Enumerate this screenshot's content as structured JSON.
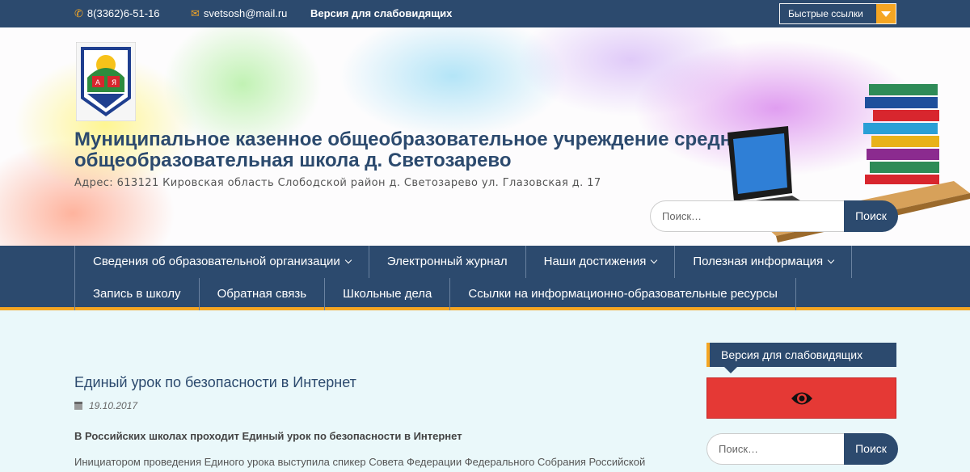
{
  "topbar": {
    "phone": "8(3362)6-51-16",
    "phone_icon": "phone-icon",
    "email": "svetsosh@mail.ru",
    "email_icon": "envelope-icon",
    "vision_link": "Версия для слабовидящих",
    "quick_links": "Быстрые ссылки"
  },
  "header": {
    "title": "Муниципальное казенное общеобразовательное учреждение средняя общеобразовательная школа д. Светозарево",
    "address": "Адрес: 613121 Кировская область Слободской район д. Светозарево ул. Глазовская д. 17",
    "search_placeholder": "Поиск…",
    "search_button": "Поиск"
  },
  "nav": {
    "row1": [
      {
        "label": "Сведения об образовательной организации",
        "dropdown": true
      },
      {
        "label": "Электронный журнал",
        "dropdown": false
      },
      {
        "label": "Наши достижения",
        "dropdown": true
      },
      {
        "label": "Полезная информация",
        "dropdown": true
      }
    ],
    "row2": [
      {
        "label": "Запись в школу"
      },
      {
        "label": "Обратная связь"
      },
      {
        "label": "Школьные дела"
      },
      {
        "label": "Ссылки на информационно-образовательные ресурсы"
      }
    ]
  },
  "post": {
    "title": "Единый урок по безопасности в Интернет",
    "date": "19.10.2017",
    "lead": "В Российских школах проходит Единый урок по безопасности в Интернет",
    "text": "Инициатором проведения Единого урока выступила спикер Совета Федерации Федерального Собрания Российской"
  },
  "sidebar": {
    "vision_title": "Версия для слабовидящих",
    "search_placeholder": "Поиск…",
    "search_button": "Поиск"
  },
  "colors": {
    "primary": "#2c4a6e",
    "accent": "#f5a623",
    "vision_button": "#e53935",
    "page_background": "#eaf8fa"
  }
}
